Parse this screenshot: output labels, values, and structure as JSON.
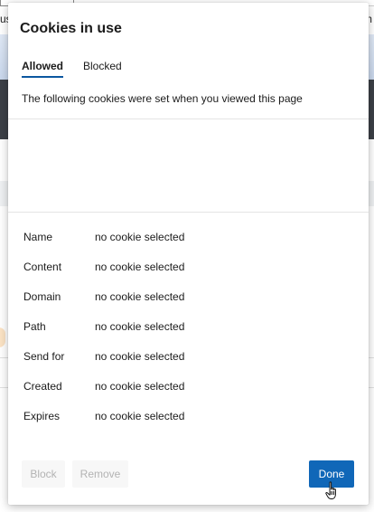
{
  "background": {
    "left_fragment": "us",
    "right_fragment": "m"
  },
  "dialog": {
    "title": "Cookies in use",
    "tabs": [
      {
        "label": "Allowed",
        "active": true
      },
      {
        "label": "Blocked",
        "active": false
      }
    ],
    "description": "The following cookies were set when you viewed this page",
    "details": [
      {
        "label": "Name",
        "value": "no cookie selected"
      },
      {
        "label": "Content",
        "value": "no cookie selected"
      },
      {
        "label": "Domain",
        "value": "no cookie selected"
      },
      {
        "label": "Path",
        "value": "no cookie selected"
      },
      {
        "label": "Send for",
        "value": "no cookie selected"
      },
      {
        "label": "Created",
        "value": "no cookie selected"
      },
      {
        "label": "Expires",
        "value": "no cookie selected"
      }
    ],
    "buttons": {
      "block_label": "Block",
      "remove_label": "Remove",
      "done_label": "Done"
    }
  },
  "colors": {
    "accent": "#1067b8",
    "tab_underline": "#0b57a0"
  }
}
